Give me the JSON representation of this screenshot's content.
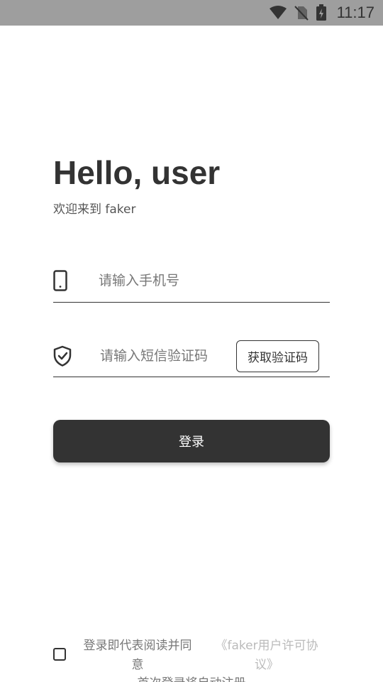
{
  "status_bar": {
    "time": "11:17",
    "icons": [
      "wifi-icon",
      "no-sim-icon",
      "battery-charging-icon"
    ]
  },
  "greeting": {
    "title": "Hello, user",
    "subtitle": "欢迎来到 faker"
  },
  "form": {
    "phone": {
      "icon": "phone-icon",
      "placeholder": "请输入手机号",
      "value": ""
    },
    "code": {
      "icon": "shield-check-icon",
      "placeholder": "请输入短信验证码",
      "value": "",
      "get_code_label": "获取验证码"
    },
    "login_label": "登录"
  },
  "agreement": {
    "checked": false,
    "text": "登录即代表阅读并同意",
    "link": "《faker用户许可协议》",
    "note": "首次登录将自动注册"
  },
  "colors": {
    "status_bar_bg": "#9e9e9e",
    "primary_dark": "#333333",
    "button_text": "#ffffff",
    "muted_text": "#777777",
    "link_text": "#bbbbbb"
  }
}
